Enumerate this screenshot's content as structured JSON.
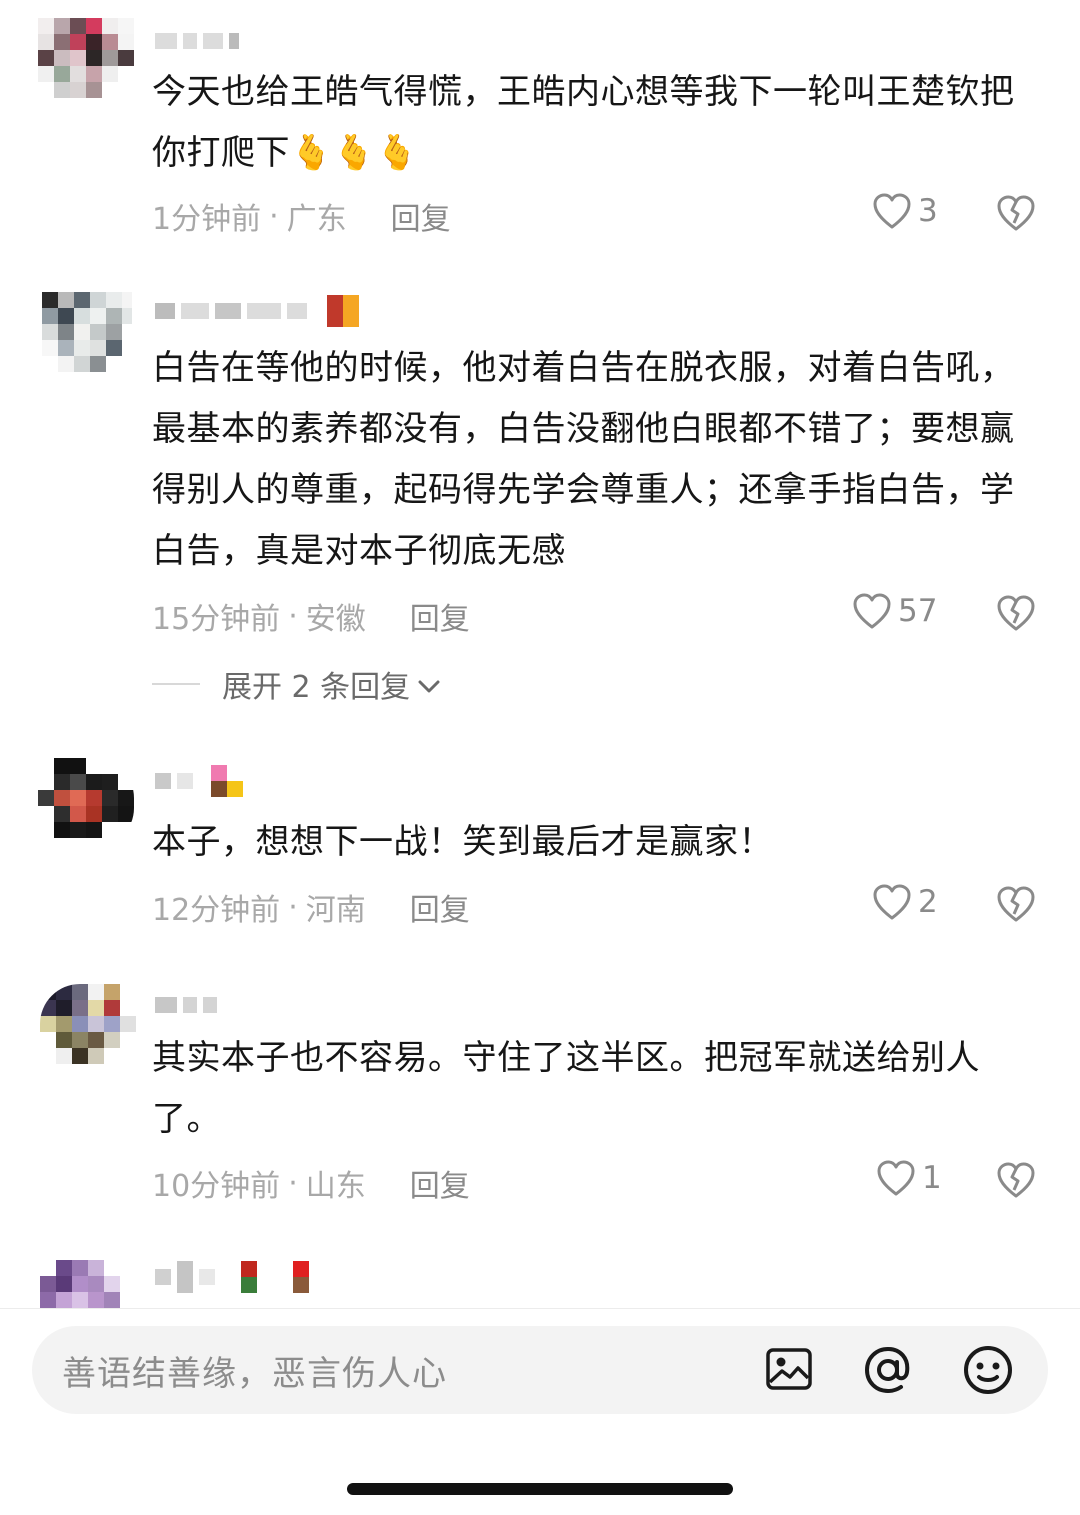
{
  "comments": [
    {
      "text": "今天也给王皓气得慌，王皓内心想等我下一轮叫王楚钦把你打爬下",
      "emoji": "🫰🫰🫰",
      "time": "1分钟前",
      "location": "广东",
      "reply_label": "回复",
      "likes": "3"
    },
    {
      "text": "白告在等他的时候，他对着白告在脱衣服，对着白告吼，最基本的素养都没有，白告没翻他白眼都不错了；要想赢得别人的尊重，起码得先学会尊重人；还拿手指白告，学白告，真是对本子彻底无感",
      "time": "15分钟前",
      "location": "安徽",
      "reply_label": "回复",
      "likes": "57",
      "expand_label": "展开 2 条回复"
    },
    {
      "text": "本子，想想下一战！笑到最后才是赢家！",
      "time": "12分钟前",
      "location": "河南",
      "reply_label": "回复",
      "likes": "2"
    },
    {
      "text": "其实本子也不容易。守住了这半区。把冠军就送给别人了。",
      "time": "10分钟前",
      "location": "山东",
      "reply_label": "回复",
      "likes": "1"
    }
  ],
  "meta_separator": "·",
  "input": {
    "placeholder": "善语结善缘，恶言伤人心"
  },
  "icons": [
    "heart-icon",
    "broken-heart-icon",
    "image-icon",
    "at-icon",
    "emoji-icon",
    "chevron-down-icon"
  ],
  "colors": {
    "text": "#161616",
    "meta": "#a8a8a8",
    "input_bg": "#f3f3f3"
  }
}
